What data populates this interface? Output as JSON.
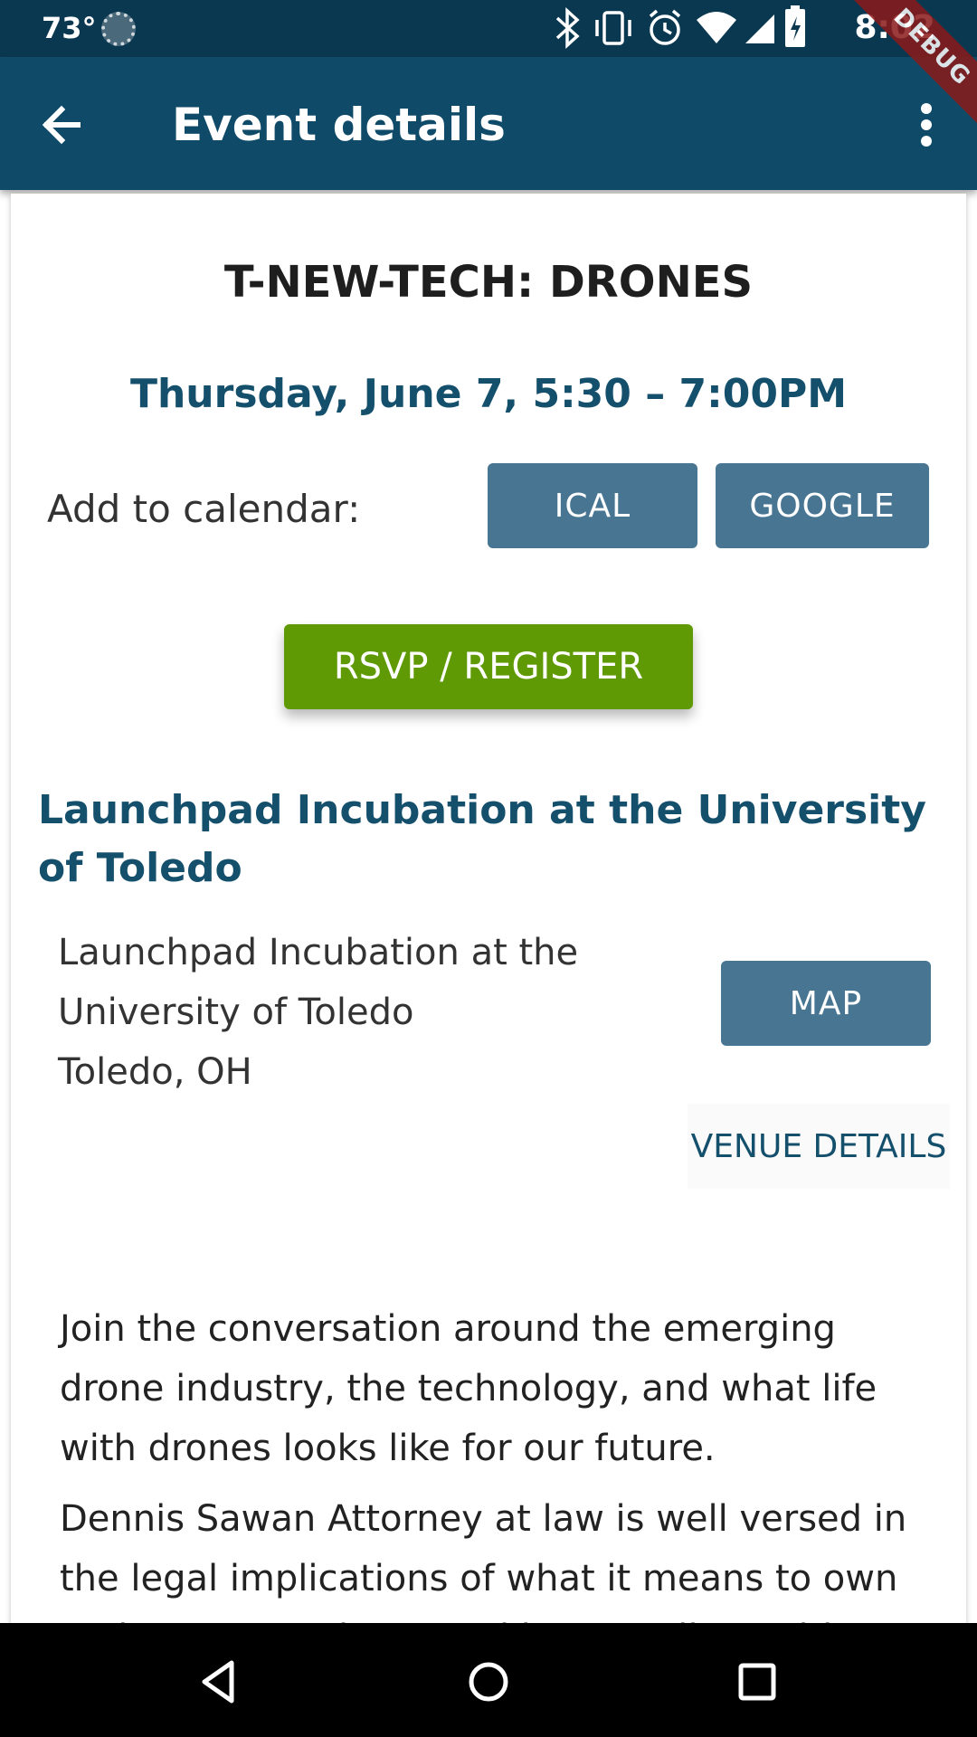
{
  "status_bar": {
    "temperature": "73°",
    "time": "8:02",
    "debug_label": "DEBUG"
  },
  "app_bar": {
    "title": "Event details"
  },
  "event": {
    "title": "T-NEW-TECH: DRONES",
    "date": "Thursday, June 7, 5:30 – 7:00PM",
    "add_to_calendar_label": "Add to calendar:",
    "ical_label": "ICAL",
    "google_label": "GOOGLE",
    "rsvp_label": "RSVP / REGISTER"
  },
  "venue": {
    "title": "Launchpad Incubation at the University of Toledo",
    "address_line1": "Launchpad Incubation at the",
    "address_line2": "University of Toledo",
    "address_line3": "Toledo, OH",
    "map_label": "MAP",
    "details_label": "VENUE DETAILS"
  },
  "description": {
    "paragraph1": "Join the conversation around the emerging drone industry, the technology, and what life with drones looks like for our future.",
    "paragraph2": "Dennis Sawan Attorney at law is well versed in the legal implications of what it means to own and operate a drone and be compliant with FAA"
  },
  "colors": {
    "app_bar": "#0f4a68",
    "status_bar": "#0b3851",
    "button_blue": "#477592",
    "rsvp_green": "#5f9a05",
    "accent_text": "#144f6c"
  }
}
